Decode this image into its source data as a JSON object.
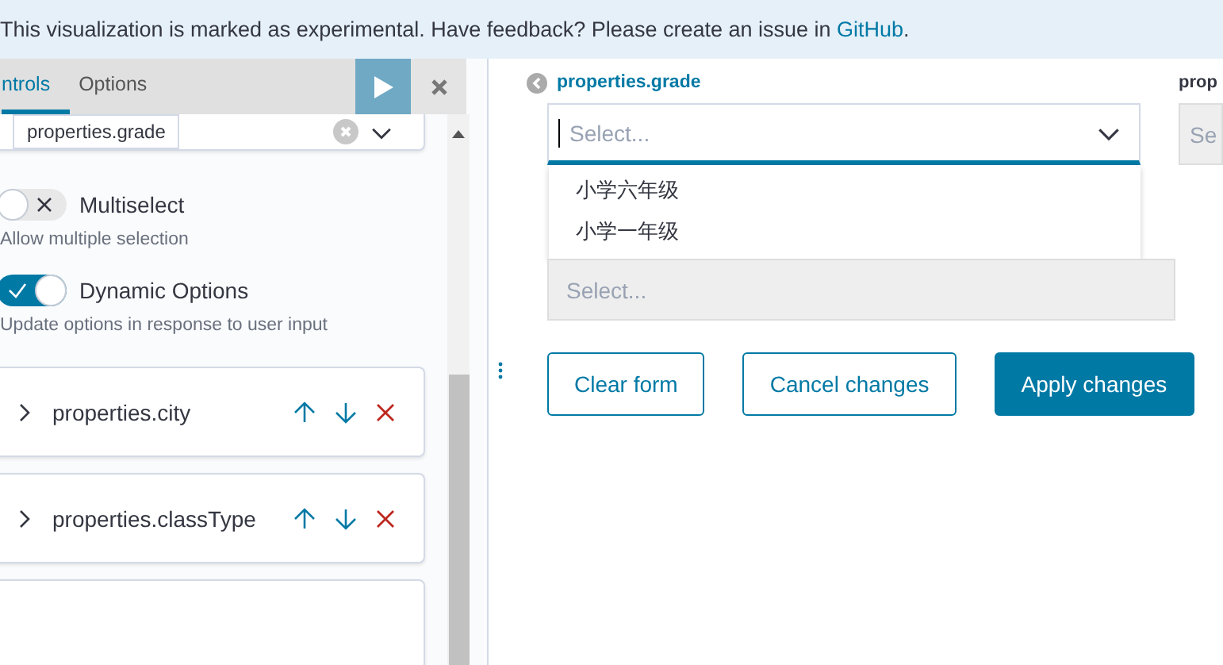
{
  "banner": {
    "text": "This visualization is marked as experimental. Have feedback? Please create an issue in ",
    "link": "GitHub",
    "after": "."
  },
  "editor": {
    "tabs": [
      {
        "label": "ntrols",
        "selected": true
      },
      {
        "label": "Options",
        "selected": false
      }
    ],
    "field_card": {
      "field": "properties.grade"
    },
    "toggles": [
      {
        "label": "Multiselect",
        "help": "Allow multiple selection",
        "on": false
      },
      {
        "label": "Dynamic Options",
        "help": "Update options in response to user input",
        "on": true
      }
    ],
    "controls": [
      {
        "name": "properties.city",
        "expanded": false
      },
      {
        "name": "properties.classType",
        "expanded": false
      }
    ]
  },
  "form": {
    "control_1": {
      "label": "properties.grade",
      "placeholder": "Select...",
      "options": [
        "小学六年级",
        "小学一年级"
      ]
    },
    "control_2": {
      "placeholder": "Select..."
    },
    "control_3": {
      "label": "prop",
      "placeholder": "Se"
    },
    "buttons": [
      {
        "label": "Clear form",
        "kind": "outline"
      },
      {
        "label": "Cancel changes",
        "kind": "outline"
      },
      {
        "label": "Apply changes",
        "kind": "primary"
      }
    ]
  }
}
